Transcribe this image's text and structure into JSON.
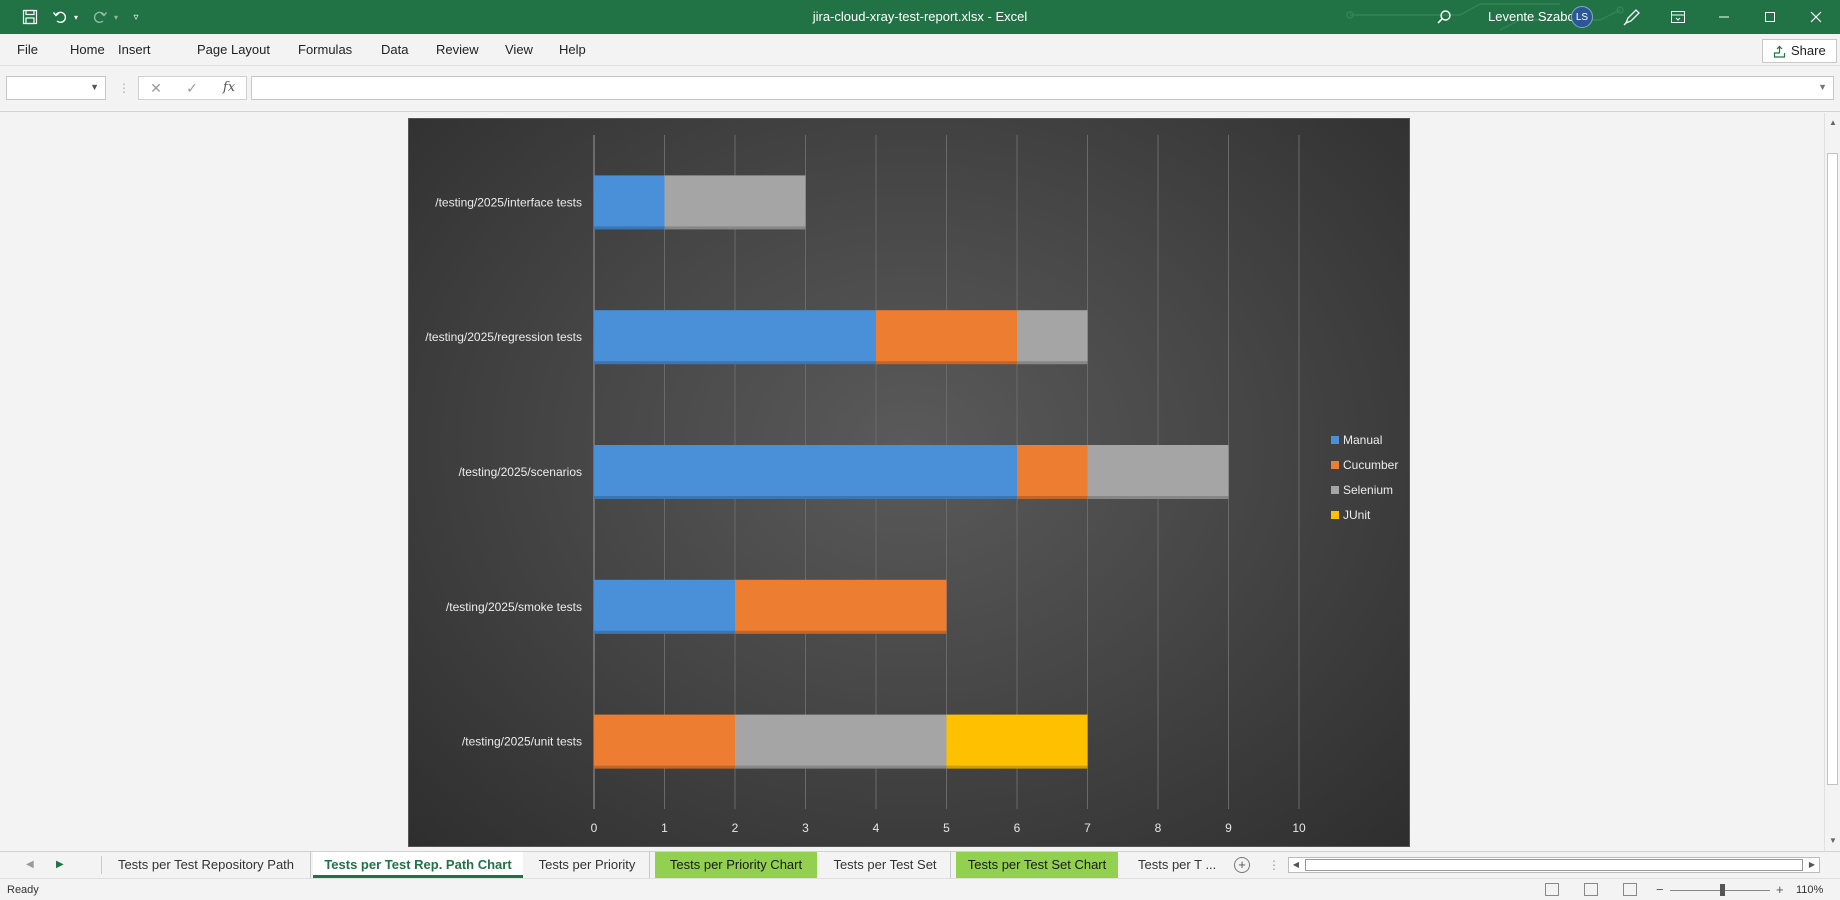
{
  "window": {
    "title": "jira-cloud-xray-test-report.xlsx  -  Excel",
    "user_name": "Levente Szabo",
    "user_initials": "LS"
  },
  "menu": {
    "items": [
      "File",
      "Home",
      "Insert",
      "Page Layout",
      "Formulas",
      "Data",
      "Review",
      "View",
      "Help"
    ],
    "share_label": "Share"
  },
  "formula_bar": {
    "name_box_value": "",
    "fx_label": "fx",
    "formula_value": ""
  },
  "chart_data": {
    "type": "bar",
    "orientation": "horizontal",
    "stacked": true,
    "categories": [
      "/testing/2025/interface tests",
      "/testing/2025/regression tests",
      "/testing/2025/scenarios",
      "/testing/2025/smoke tests",
      "/testing/2025/unit tests"
    ],
    "series": [
      {
        "name": "Manual",
        "color": "#4a90d9",
        "values": [
          1,
          4,
          6,
          2,
          0
        ]
      },
      {
        "name": "Cucumber",
        "color": "#ed7d31",
        "values": [
          0,
          2,
          1,
          3,
          2
        ]
      },
      {
        "name": "Selenium",
        "color": "#a5a5a5",
        "values": [
          2,
          1,
          2,
          0,
          3
        ]
      },
      {
        "name": "JUnit",
        "color": "#ffc000",
        "values": [
          0,
          0,
          0,
          0,
          2
        ]
      }
    ],
    "xlim": [
      0,
      10
    ],
    "xticks": [
      "0",
      "1",
      "2",
      "3",
      "4",
      "5",
      "6",
      "7",
      "8",
      "9",
      "10"
    ],
    "grid": true,
    "legend_position": "right",
    "title": "",
    "xlabel": "",
    "ylabel": ""
  },
  "sheet_tabs": [
    {
      "label": "Tests per Test Repository Path",
      "style": "normal"
    },
    {
      "label": "Tests per Test Rep. Path Chart",
      "style": "active"
    },
    {
      "label": "Tests per Priority",
      "style": "normal"
    },
    {
      "label": "Tests per Priority Chart",
      "style": "green"
    },
    {
      "label": "Tests per Test Set",
      "style": "normal"
    },
    {
      "label": "Tests per Test Set Chart",
      "style": "green"
    },
    {
      "label": "Tests per T ...",
      "style": "normal"
    }
  ],
  "status": {
    "text": "Ready",
    "zoom": "110%"
  }
}
